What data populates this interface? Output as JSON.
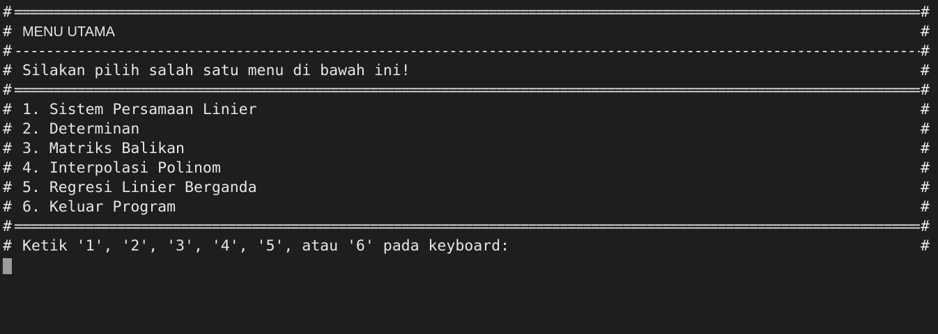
{
  "terminal": {
    "border_char": "#",
    "double_rule": "================================================================================================================================",
    "single_rule": "--------------------------------------------------------------------------------------------------------------------------------",
    "header_title": "MENU UTAMA",
    "instruction": "Silakan pilih salah satu menu di bawah ini!",
    "menu_items": [
      "1. Sistem Persamaan Linier",
      "2. Determinan",
      "3. Matriks Balikan",
      "4. Interpolasi Polinom",
      "5. Regresi Linier Berganda",
      "6. Keluar Program"
    ],
    "prompt": "Ketik '1', '2', '3', '4', '5', atau '6' pada keyboard:"
  },
  "colors": {
    "background": "#1e1e1e",
    "text": "#e6e6e6",
    "cursor": "#9b9b9b"
  }
}
